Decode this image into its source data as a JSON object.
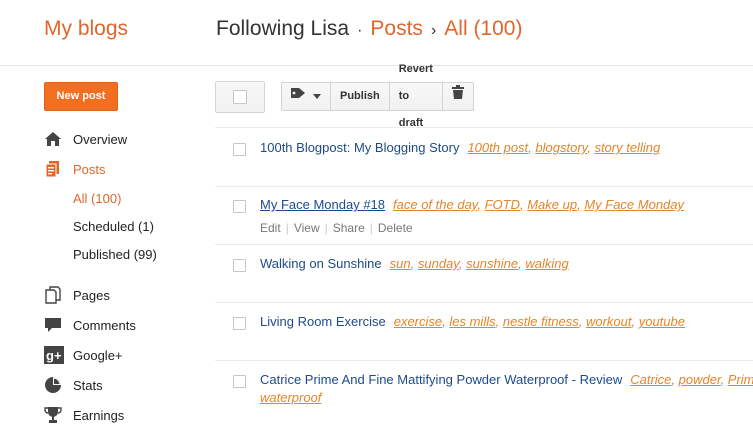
{
  "header": {
    "brand": "My blogs",
    "blog_name": "Following Lisa",
    "dot": "·",
    "posts_link": "Posts",
    "sep": "›",
    "all_link": "All (100)"
  },
  "sidebar": {
    "new_post": "New post",
    "items": [
      {
        "label": "Overview",
        "icon": "home-icon"
      },
      {
        "label": "Posts",
        "icon": "posts-icon"
      },
      {
        "label": "Pages",
        "icon": "pages-icon"
      },
      {
        "label": "Comments",
        "icon": "comments-icon"
      },
      {
        "label": "Google+",
        "icon": "google-plus-icon"
      },
      {
        "label": "Stats",
        "icon": "stats-icon"
      },
      {
        "label": "Earnings",
        "icon": "earnings-icon"
      }
    ],
    "sub": [
      {
        "label": "All (100)"
      },
      {
        "label": "Scheduled (1)"
      },
      {
        "label": "Published (99)"
      }
    ]
  },
  "toolbar": {
    "publish": "Publish",
    "revert": "Revert to draft"
  },
  "posts": [
    {
      "title": "100th Blogpost: My Blogging Story",
      "labels": [
        "100th post",
        "blogstory",
        "story telling"
      ]
    },
    {
      "title": "My Face Monday #18",
      "labels": [
        "face of the day",
        "FOTD",
        "Make up",
        "My Face Monday"
      ]
    },
    {
      "title": "Walking on Sunshine",
      "labels": [
        "sun",
        "sunday",
        "sunshine",
        "walking"
      ]
    },
    {
      "title": "Living Room Exercise",
      "labels": [
        "exercise",
        "les mills",
        "nestle fitness",
        "workout",
        "youtube"
      ]
    },
    {
      "title": "Catrice Prime And Fine Mattifying Powder Waterproof - Review",
      "labels": [
        "Catrice",
        "powder",
        "Prim"
      ],
      "labels_line2": "waterproof"
    }
  ],
  "row_actions": {
    "edit": "Edit",
    "view": "View",
    "share": "Share",
    "delete": "Delete",
    "pipe": "|"
  },
  "colors": {
    "accent": "#e0662c",
    "new_post_bg": "#f26e21",
    "title_link": "#1e4a8c",
    "label_link": "#e0862c"
  }
}
